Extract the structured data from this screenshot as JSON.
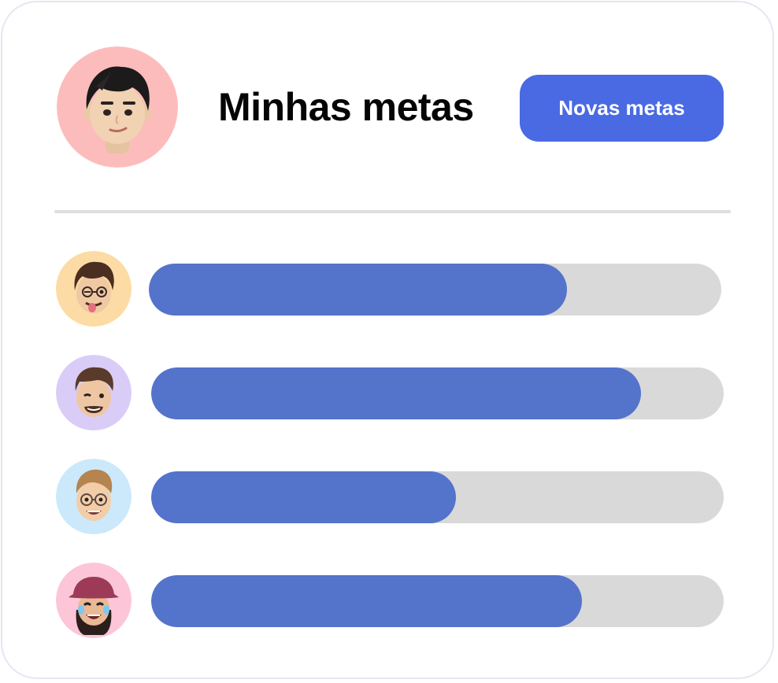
{
  "header": {
    "title": "Minhas metas",
    "new_goals_button": "Novas metas",
    "avatar_icon": "memoji-avatar-icon",
    "avatar_bg": "#fdbcbc"
  },
  "colors": {
    "accent": "#4a6ae3",
    "progress_fill": "#5473cb",
    "progress_track": "#d9d9d9",
    "divider": "#dedede"
  },
  "goals": [
    {
      "avatar_icon": "memoji-tongue-out-icon",
      "avatar_bg": "#fddba4",
      "progress": 0.73
    },
    {
      "avatar_icon": "memoji-wink-icon",
      "avatar_bg": "#d9cdf7",
      "progress": 0.855
    },
    {
      "avatar_icon": "memoji-glasses-icon",
      "avatar_bg": "#cbe9fb",
      "progress": 0.533
    },
    {
      "avatar_icon": "memoji-laughing-hat-icon",
      "avatar_bg": "#fcc5d8",
      "progress": 0.752
    }
  ]
}
